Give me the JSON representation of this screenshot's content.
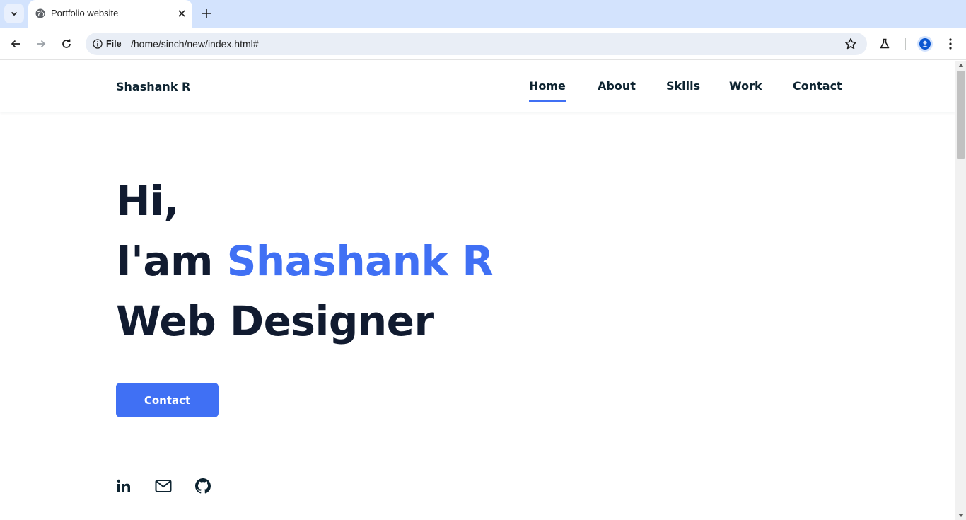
{
  "browser": {
    "tab_title": "Portfolio website",
    "url_scheme_label": "File",
    "url": "/home/sinch/new/index.html#"
  },
  "site": {
    "logo": "Shashank R",
    "nav": [
      {
        "label": "Home",
        "active": true
      },
      {
        "label": "About",
        "active": false
      },
      {
        "label": "Skills",
        "active": false
      },
      {
        "label": "Work",
        "active": false
      },
      {
        "label": "Contact",
        "active": false
      }
    ]
  },
  "hero": {
    "line1": "Hi,",
    "line2_prefix": "I'am ",
    "name": "Shashank R",
    "line3": "Web Designer",
    "cta_label": "Contact"
  },
  "social": [
    {
      "icon": "linkedin-icon"
    },
    {
      "icon": "mail-icon"
    },
    {
      "icon": "github-icon"
    }
  ],
  "colors": {
    "accent": "#4070f4",
    "heading": "#111b30",
    "tabstrip": "#d3e3fd"
  }
}
